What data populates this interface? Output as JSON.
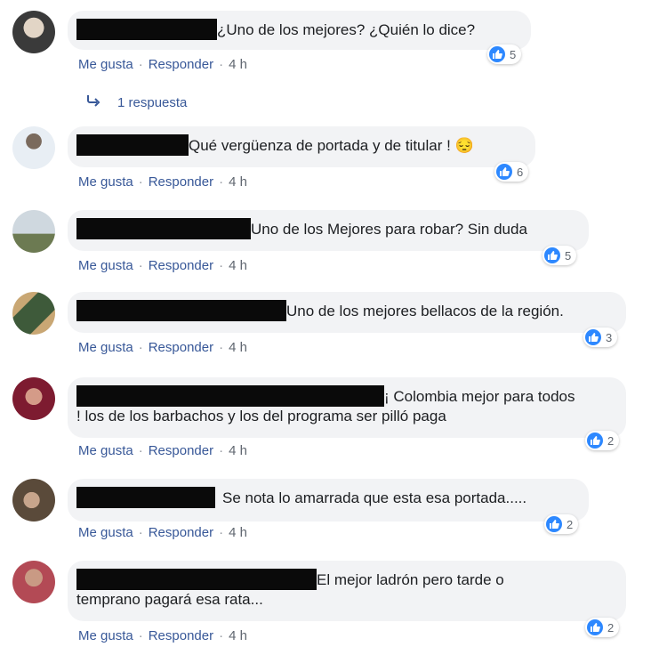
{
  "comments": [
    {
      "text": "¿Uno de los mejores? ¿Quién lo dice?",
      "reactions": "5",
      "like": "Me gusta",
      "reply": "Responder",
      "time": "4 h"
    },
    {
      "text": "Qué vergüenza de portada y de titular ! 😔",
      "reactions": "6",
      "like": "Me gusta",
      "reply": "Responder",
      "time": "4 h"
    },
    {
      "text": "Uno de los Mejores para robar? Sin duda",
      "reactions": "5",
      "like": "Me gusta",
      "reply": "Responder",
      "time": "4 h"
    },
    {
      "text": "Uno de los mejores bellacos de la región.",
      "reactions": "3",
      "like": "Me gusta",
      "reply": "Responder",
      "time": "4 h"
    },
    {
      "text": "¡ Colombia mejor para todos",
      "text2": "! los de los barbachos y los del programa ser pilló paga",
      "reactions": "2",
      "like": "Me gusta",
      "reply": "Responder",
      "time": "4 h"
    },
    {
      "text": "Se nota lo amarrada que esta esa portada.....",
      "reactions": "2",
      "like": "Me gusta",
      "reply": "Responder",
      "time": "4 h"
    },
    {
      "text": "El mejor ladrón pero tarde o",
      "text2": "temprano pagará esa rata...",
      "reactions": "2",
      "like": "Me gusta",
      "reply": "Responder",
      "time": "4 h"
    }
  ],
  "replies_label": "1 respuesta",
  "colors": {
    "accent": "#385898",
    "like_blue": "#2d88ff",
    "bubble": "#f2f3f5"
  },
  "icons": [
    "reply-arrow-icon",
    "thumbs-up-icon"
  ]
}
